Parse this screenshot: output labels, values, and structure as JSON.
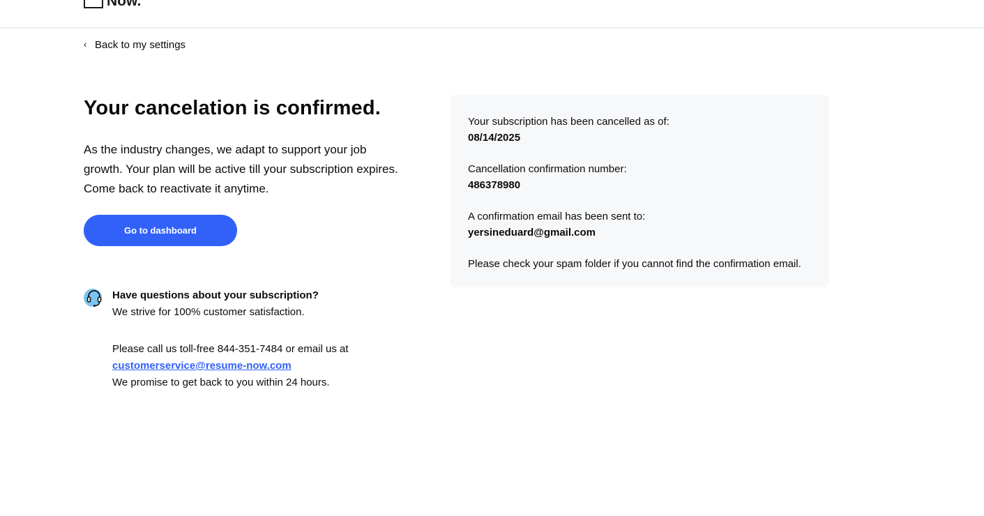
{
  "header": {
    "logo_text": "Now."
  },
  "nav": {
    "back_label": "Back to my settings"
  },
  "main": {
    "title": "Your cancelation is confirmed.",
    "intro": "As the industry changes, we adapt to support your job growth. Your plan will be active till your subscription expires. Come back to reactivate it anytime.",
    "dashboard_button": "Go to dashboard"
  },
  "help": {
    "icon": "headset-icon",
    "question": "Have questions about your subscription?",
    "satisfaction": "We strive for 100% customer satisfaction.",
    "call_text": "Please call us toll-free 844-351-7484 or email us at",
    "email_link": "customerservice@resume-now.com",
    "promise": "We promise to get back to you within 24 hours."
  },
  "summary": {
    "cancelled_label": "Your subscription has been cancelled as of:",
    "cancelled_date": "08/14/2025",
    "confirmation_label": "Cancellation confirmation number:",
    "confirmation_number": "486378980",
    "email_label": "A confirmation email has been sent to:",
    "email_value": "yersineduard@gmail.com",
    "spam_note": "Please check your spam folder if you cannot find the confirmation email."
  },
  "colors": {
    "accent": "#3161f9",
    "card_background": "#f7f8fa",
    "icon_background": "#7cc4f4"
  }
}
